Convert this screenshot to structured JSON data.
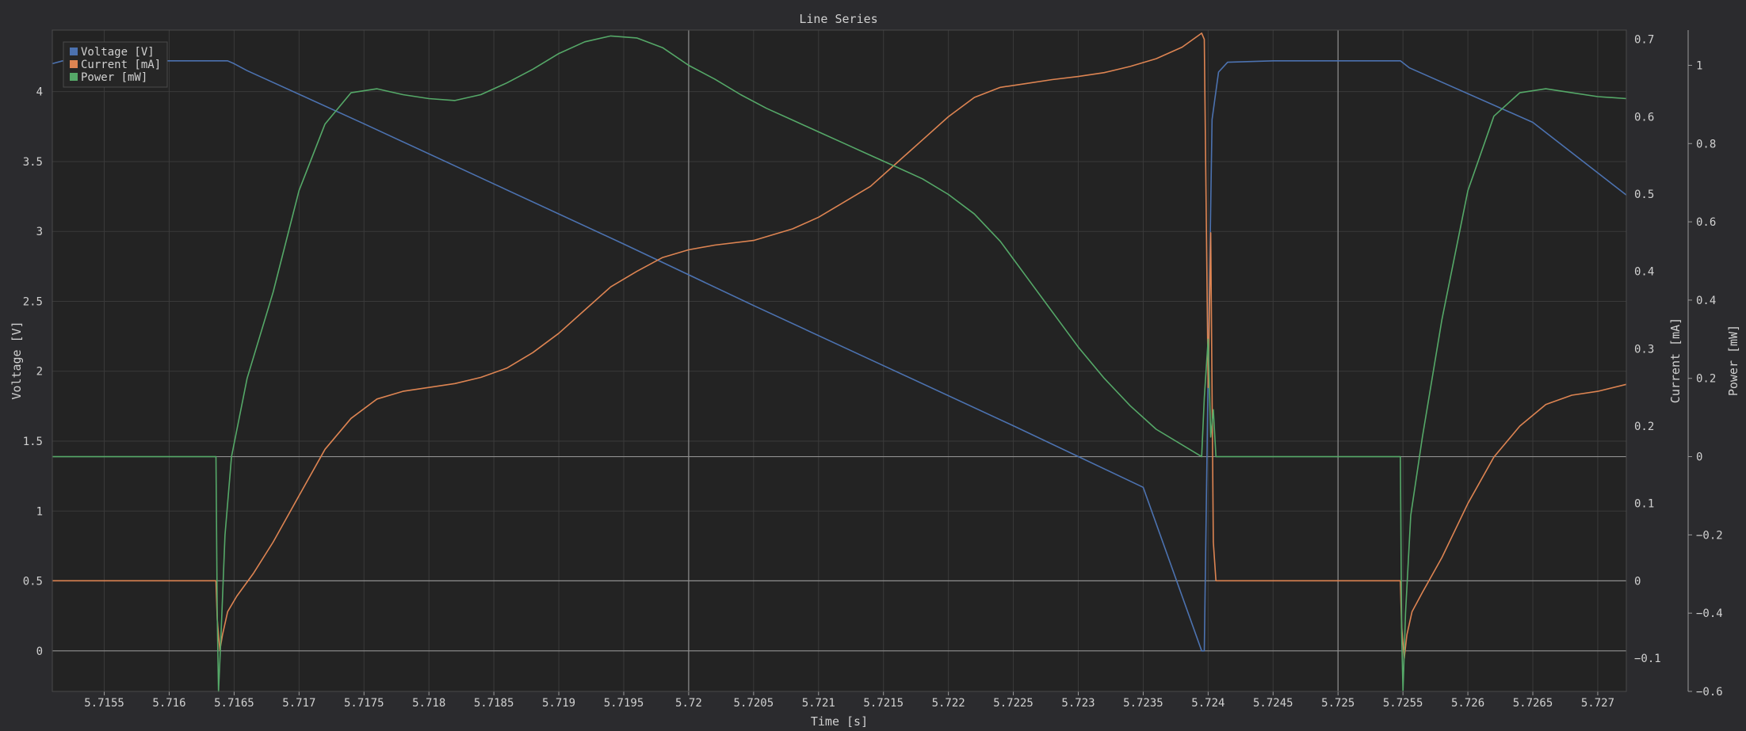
{
  "colors": {
    "background": "#2b2b2e",
    "plot_background": "#232323",
    "grid": "#3a3a3a",
    "zero_line": "#8f8f8f",
    "axis_text": "#d0d0d0",
    "voltage": "#4c72b0",
    "current": "#dd8452",
    "power": "#55a868"
  },
  "chart_data": {
    "type": "line",
    "title": "Line Series",
    "xlabel": "Time [s]",
    "xlim": [
      5.7151,
      5.72722
    ],
    "xticks": [
      "5.7155",
      "5.716",
      "5.7165",
      "5.717",
      "5.7175",
      "5.718",
      "5.7185",
      "5.719",
      "5.7195",
      "5.72",
      "5.7205",
      "5.721",
      "5.7215",
      "5.722",
      "5.7225",
      "5.723",
      "5.7235",
      "5.724",
      "5.7245",
      "5.725",
      "5.7255",
      "5.726",
      "5.7265",
      "5.727"
    ],
    "axes": [
      {
        "id": "voltage",
        "label": "Voltage [V]",
        "side": "left",
        "ylim": [
          -0.29,
          4.44
        ],
        "ticks": [
          "0",
          "0.5",
          "1",
          "1.5",
          "2",
          "2.5",
          "3",
          "3.5",
          "4"
        ]
      },
      {
        "id": "current",
        "label": "Current [mA]",
        "side": "right",
        "ylim": [
          -0.143,
          0.712
        ],
        "ticks": [
          "−0.1",
          "0",
          "0.1",
          "0.2",
          "0.3",
          "0.4",
          "0.5",
          "0.6",
          "0.7"
        ]
      },
      {
        "id": "power",
        "label": "Power [mW]",
        "side": "right-outer",
        "ylim": [
          -0.6,
          1.09
        ],
        "ticks": [
          "−0.6",
          "−0.4",
          "−0.2",
          "0",
          "0.2",
          "0.4",
          "0.6",
          "0.8",
          "1"
        ]
      }
    ],
    "vlines": [
      5.72,
      5.725
    ],
    "legend": {
      "placement": "top-left",
      "entries": [
        "Voltage [V]",
        "Current [mA]",
        "Power [mW]"
      ]
    },
    "grid": true,
    "series": [
      {
        "name": "Voltage [V]",
        "axis": "voltage",
        "color": "#4c72b0",
        "points": [
          [
            5.7151,
            4.2
          ],
          [
            5.71518,
            4.22
          ],
          [
            5.71645,
            4.22
          ],
          [
            5.7165,
            4.2
          ],
          [
            5.7166,
            4.15
          ],
          [
            5.7175,
            3.77
          ],
          [
            5.7185,
            3.34
          ],
          [
            5.7195,
            2.91
          ],
          [
            5.7205,
            2.47
          ],
          [
            5.7215,
            2.04
          ],
          [
            5.7225,
            1.61
          ],
          [
            5.7235,
            1.17
          ],
          [
            5.72395,
            0.0
          ],
          [
            5.72397,
            0.0
          ],
          [
            5.724,
            2.0
          ],
          [
            5.72403,
            3.8
          ],
          [
            5.72408,
            4.14
          ],
          [
            5.72415,
            4.21
          ],
          [
            5.7245,
            4.22
          ],
          [
            5.72548,
            4.22
          ],
          [
            5.72555,
            4.17
          ],
          [
            5.7265,
            3.78
          ],
          [
            5.72722,
            3.26
          ]
        ]
      },
      {
        "name": "Current [mA]",
        "axis": "current",
        "color": "#dd8452",
        "points": [
          [
            5.7151,
            0.0
          ],
          [
            5.71636,
            0.0
          ],
          [
            5.71637,
            -0.05
          ],
          [
            5.71639,
            -0.09
          ],
          [
            5.71641,
            -0.07
          ],
          [
            5.71645,
            -0.04
          ],
          [
            5.71652,
            -0.02
          ],
          [
            5.71665,
            0.01
          ],
          [
            5.7168,
            0.05
          ],
          [
            5.717,
            0.11
          ],
          [
            5.7172,
            0.17
          ],
          [
            5.7174,
            0.21
          ],
          [
            5.7176,
            0.235
          ],
          [
            5.7178,
            0.245
          ],
          [
            5.718,
            0.25
          ],
          [
            5.7182,
            0.255
          ],
          [
            5.7184,
            0.263
          ],
          [
            5.7186,
            0.275
          ],
          [
            5.7188,
            0.295
          ],
          [
            5.719,
            0.32
          ],
          [
            5.7192,
            0.35
          ],
          [
            5.7194,
            0.38
          ],
          [
            5.7196,
            0.4
          ],
          [
            5.7198,
            0.418
          ],
          [
            5.72,
            0.428
          ],
          [
            5.7202,
            0.434
          ],
          [
            5.7205,
            0.44
          ],
          [
            5.7208,
            0.455
          ],
          [
            5.721,
            0.47
          ],
          [
            5.7212,
            0.49
          ],
          [
            5.7214,
            0.51
          ],
          [
            5.7216,
            0.54
          ],
          [
            5.7218,
            0.57
          ],
          [
            5.722,
            0.6
          ],
          [
            5.7222,
            0.625
          ],
          [
            5.7224,
            0.638
          ],
          [
            5.7226,
            0.643
          ],
          [
            5.7228,
            0.648
          ],
          [
            5.723,
            0.652
          ],
          [
            5.7232,
            0.657
          ],
          [
            5.7234,
            0.665
          ],
          [
            5.7236,
            0.675
          ],
          [
            5.7238,
            0.69
          ],
          [
            5.72395,
            0.708
          ],
          [
            5.72397,
            0.7
          ],
          [
            5.724,
            0.25
          ],
          [
            5.72402,
            0.45
          ],
          [
            5.72404,
            0.05
          ],
          [
            5.72406,
            0.0
          ],
          [
            5.72548,
            0.0
          ],
          [
            5.72549,
            -0.06
          ],
          [
            5.72551,
            -0.1
          ],
          [
            5.72553,
            -0.07
          ],
          [
            5.72557,
            -0.04
          ],
          [
            5.72565,
            -0.015
          ],
          [
            5.7258,
            0.03
          ],
          [
            5.726,
            0.1
          ],
          [
            5.7262,
            0.16
          ],
          [
            5.7264,
            0.2
          ],
          [
            5.7266,
            0.228
          ],
          [
            5.7268,
            0.24
          ],
          [
            5.727,
            0.245
          ],
          [
            5.72722,
            0.254
          ]
        ]
      },
      {
        "name": "Power [mW]",
        "axis": "power",
        "color": "#55a868",
        "points": [
          [
            5.7151,
            0.0
          ],
          [
            5.71636,
            0.0
          ],
          [
            5.71637,
            -0.4
          ],
          [
            5.71638,
            -0.6
          ],
          [
            5.7164,
            -0.45
          ],
          [
            5.71643,
            -0.2
          ],
          [
            5.71648,
            0.0
          ],
          [
            5.7166,
            0.2
          ],
          [
            5.7168,
            0.42
          ],
          [
            5.717,
            0.68
          ],
          [
            5.7172,
            0.85
          ],
          [
            5.7174,
            0.93
          ],
          [
            5.7176,
            0.94
          ],
          [
            5.7178,
            0.925
          ],
          [
            5.718,
            0.915
          ],
          [
            5.7182,
            0.91
          ],
          [
            5.7184,
            0.925
          ],
          [
            5.7186,
            0.955
          ],
          [
            5.7188,
            0.99
          ],
          [
            5.719,
            1.03
          ],
          [
            5.7192,
            1.06
          ],
          [
            5.7194,
            1.075
          ],
          [
            5.7196,
            1.07
          ],
          [
            5.7198,
            1.045
          ],
          [
            5.72,
            1.0
          ],
          [
            5.7202,
            0.965
          ],
          [
            5.7204,
            0.925
          ],
          [
            5.7206,
            0.89
          ],
          [
            5.7208,
            0.86
          ],
          [
            5.721,
            0.83
          ],
          [
            5.7212,
            0.8
          ],
          [
            5.7214,
            0.77
          ],
          [
            5.7216,
            0.74
          ],
          [
            5.7218,
            0.71
          ],
          [
            5.722,
            0.67
          ],
          [
            5.7222,
            0.62
          ],
          [
            5.7224,
            0.55
          ],
          [
            5.7226,
            0.46
          ],
          [
            5.7228,
            0.37
          ],
          [
            5.723,
            0.28
          ],
          [
            5.7232,
            0.2
          ],
          [
            5.7234,
            0.13
          ],
          [
            5.7236,
            0.07
          ],
          [
            5.72395,
            0.0
          ],
          [
            5.72397,
            0.15
          ],
          [
            5.724,
            0.3
          ],
          [
            5.72402,
            0.05
          ],
          [
            5.72404,
            0.12
          ],
          [
            5.72406,
            0.0
          ],
          [
            5.72548,
            0.0
          ],
          [
            5.72549,
            -0.45
          ],
          [
            5.7255,
            -0.6
          ],
          [
            5.72552,
            -0.4
          ],
          [
            5.72556,
            -0.15
          ],
          [
            5.72565,
            0.05
          ],
          [
            5.7258,
            0.35
          ],
          [
            5.726,
            0.68
          ],
          [
            5.7262,
            0.87
          ],
          [
            5.7264,
            0.93
          ],
          [
            5.7266,
            0.94
          ],
          [
            5.7268,
            0.93
          ],
          [
            5.727,
            0.92
          ],
          [
            5.72722,
            0.915
          ]
        ]
      }
    ]
  }
}
